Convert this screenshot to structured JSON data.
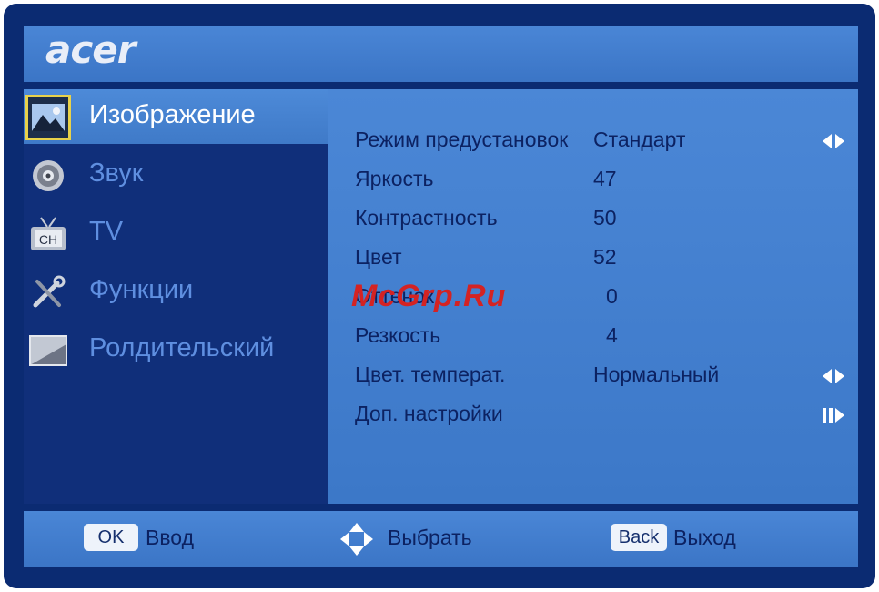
{
  "brand": {
    "logo": "acer"
  },
  "menu": [
    {
      "id": "picture",
      "label": "Изображение",
      "icon": "picture-icon",
      "selected": true
    },
    {
      "id": "sound",
      "label": "Звук",
      "icon": "speaker-icon",
      "selected": false
    },
    {
      "id": "tv",
      "label": "TV",
      "icon": "tv-channel-icon",
      "selected": false
    },
    {
      "id": "functions",
      "label": "Функции",
      "icon": "tools-icon",
      "selected": false
    },
    {
      "id": "parental",
      "label": "Ролдительский",
      "icon": "parental-lock-icon",
      "selected": false
    }
  ],
  "settings": [
    {
      "label": "Режим предустановок",
      "value": "Стандарт",
      "control": "left-right"
    },
    {
      "label": "Яркость",
      "value": "47",
      "control": ""
    },
    {
      "label": "Контрастность",
      "value": "50",
      "control": ""
    },
    {
      "label": "Цвет",
      "value": "52",
      "control": ""
    },
    {
      "label": "Оттенок",
      "value": "0",
      "control": ""
    },
    {
      "label": "Резкость",
      "value": "4",
      "control": ""
    },
    {
      "label": "Цвет. температ.",
      "value": "Нормальный",
      "control": "left-right"
    },
    {
      "label": "Доп. настройки",
      "value": "",
      "control": "enter"
    }
  ],
  "footer": {
    "ok_key": "OK",
    "ok_label": "Ввод",
    "select_label": "Выбрать",
    "back_key": "Back",
    "back_label": "Выход"
  },
  "watermark": "McGrp.Ru",
  "colors": {
    "frame": "#0b2b72",
    "panel": "#4280cf",
    "sidebar": "#102f7a",
    "text_dark": "#0c2262",
    "menu_inactive": "#5f8fe0",
    "selected_border": "#e8d24a"
  }
}
